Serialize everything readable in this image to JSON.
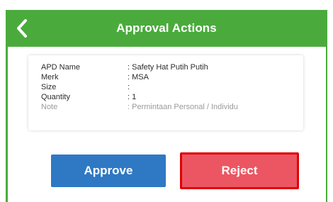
{
  "header": {
    "title": "Approval Actions",
    "back_icon": "chevron-left-icon"
  },
  "details": [
    {
      "label": "APD Name",
      "value": ": Safety Hat Putih Putih"
    },
    {
      "label": "Merk",
      "value": ": MSA"
    },
    {
      "label": "Size",
      "value": ":"
    },
    {
      "label": "Quantity",
      "value": ": 1"
    },
    {
      "label": "Note",
      "value": ": Permintaan Personal / Individu"
    }
  ],
  "actions": {
    "approve_label": "Approve",
    "reject_label": "Reject"
  },
  "colors": {
    "header_bg": "#4aab3c",
    "approve_bg": "#2f78c4",
    "reject_bg": "#ec5663",
    "reject_border": "#e00000"
  }
}
